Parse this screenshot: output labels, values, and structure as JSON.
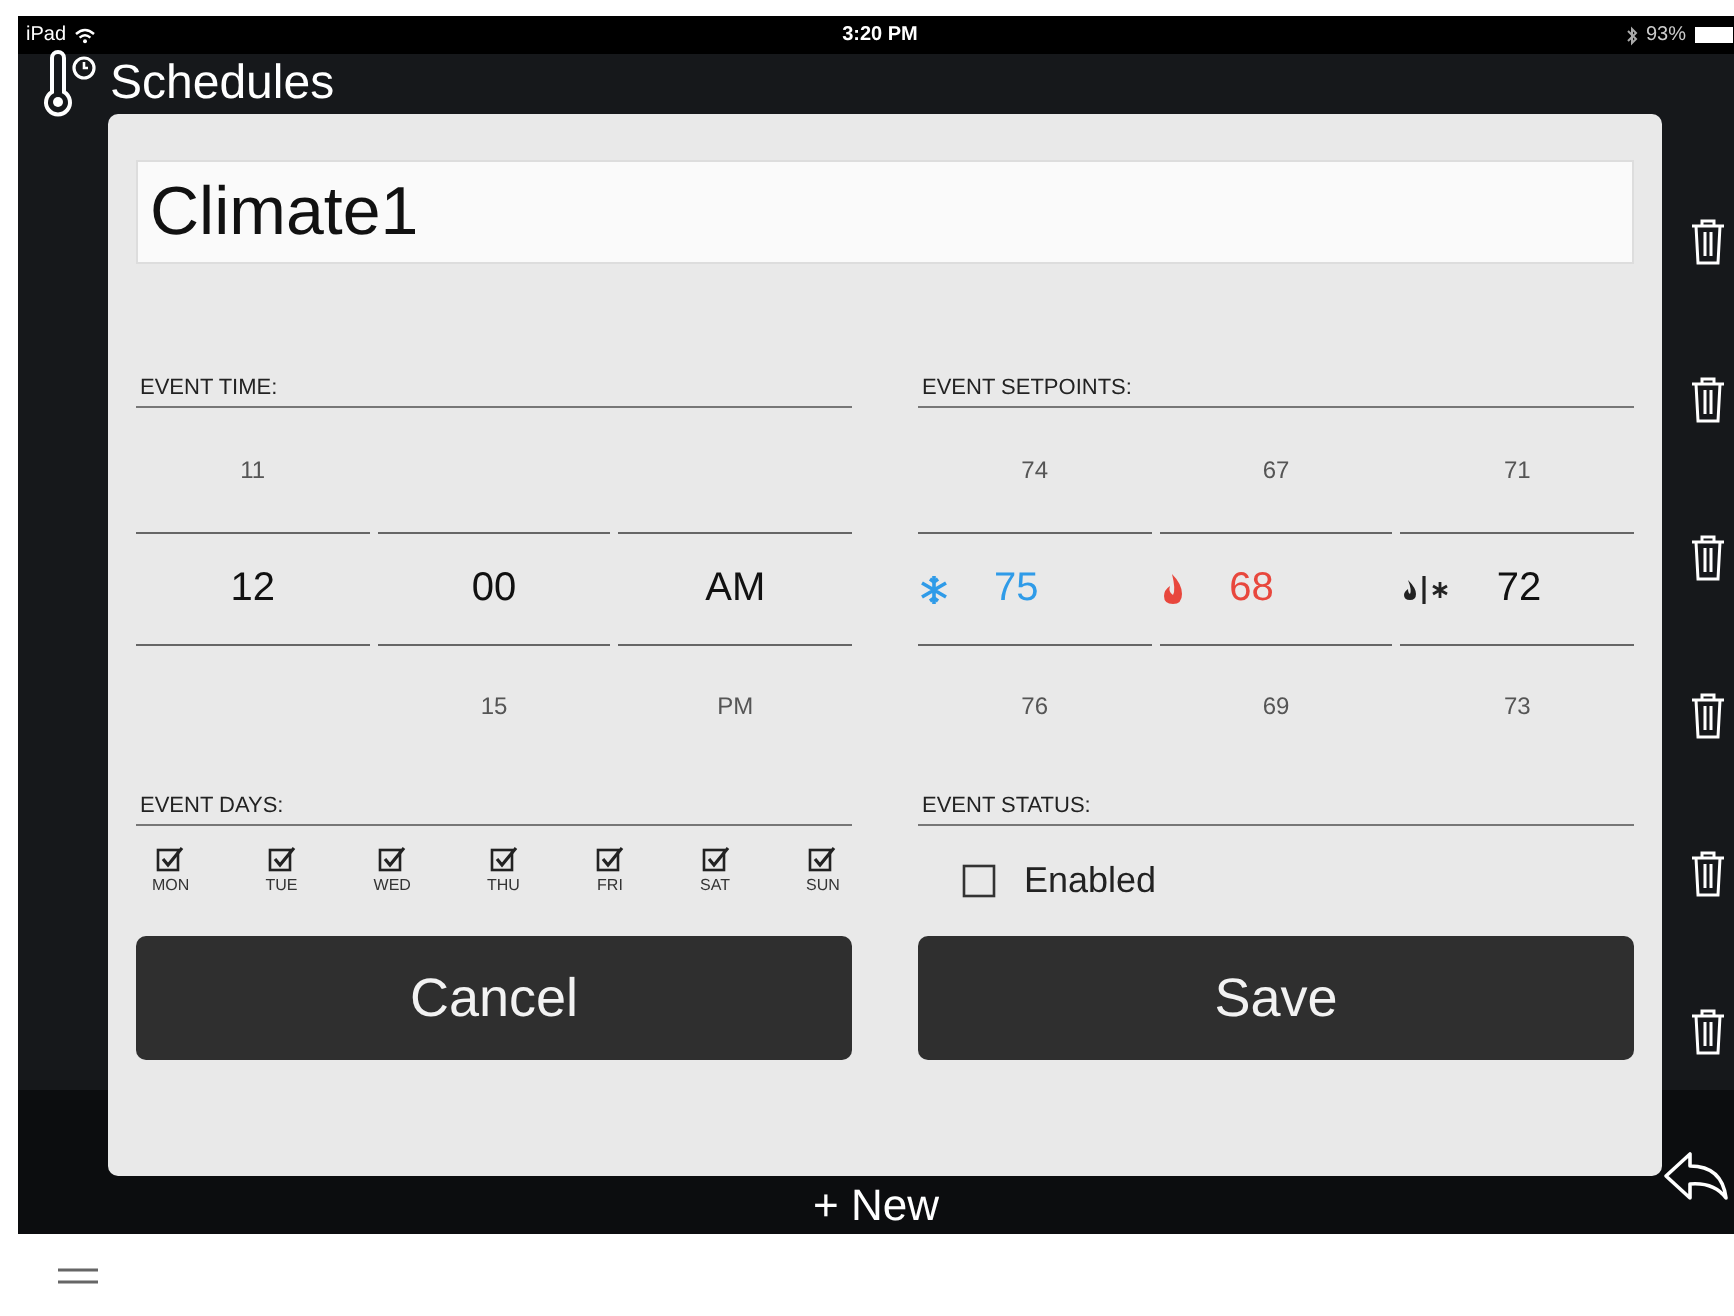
{
  "status_bar": {
    "device": "iPad",
    "time": "3:20 PM",
    "battery": "93%"
  },
  "header": {
    "title": "Schedules"
  },
  "new_button": "+ New",
  "dialog": {
    "name": {
      "value": "Climate1"
    },
    "event_time": {
      "label": "EVENT TIME:",
      "columns": [
        {
          "above": "11",
          "value": "12"
        },
        {
          "value": "00",
          "below": "15"
        },
        {
          "value": "AM",
          "below": "PM"
        }
      ]
    },
    "event_setpoints": {
      "label": "EVENT SETPOINTS:",
      "columns": [
        {
          "kind": "cool",
          "above": "74",
          "value": "75",
          "below": "76"
        },
        {
          "kind": "heat",
          "above": "67",
          "value": "68",
          "below": "69"
        },
        {
          "kind": "auto",
          "above": "71",
          "value": "72",
          "below": "73"
        }
      ]
    },
    "event_days": {
      "label": "EVENT DAYS:",
      "days": [
        {
          "label": "MON",
          "checked": true
        },
        {
          "label": "TUE",
          "checked": true
        },
        {
          "label": "WED",
          "checked": true
        },
        {
          "label": "THU",
          "checked": true
        },
        {
          "label": "FRI",
          "checked": true
        },
        {
          "label": "SAT",
          "checked": true
        },
        {
          "label": "SUN",
          "checked": true
        }
      ]
    },
    "event_status": {
      "label": "EVENT STATUS:",
      "enabled": {
        "label": "Enabled",
        "checked": false
      }
    },
    "buttons": {
      "cancel": "Cancel",
      "save": "Save"
    }
  }
}
